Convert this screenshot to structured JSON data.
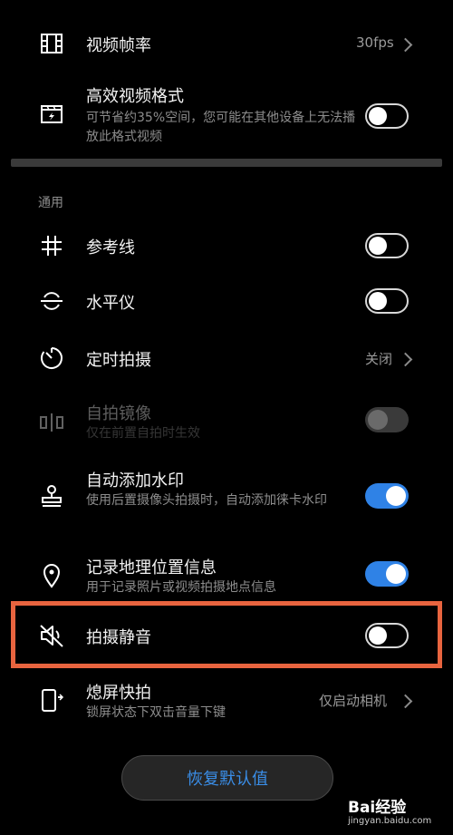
{
  "settings": {
    "frame_rate": {
      "title": "视频帧率",
      "value": "30fps",
      "icon": "film-icon"
    },
    "efficient_format": {
      "title": "高效视频格式",
      "desc": "可节省约35%空间，您可能在其他设备上无法播放此格式视频",
      "toggle": "off",
      "icon": "video-format-icon"
    },
    "section_general": "通用",
    "grid": {
      "title": "参考线",
      "toggle": "off",
      "icon": "grid-icon"
    },
    "level": {
      "title": "水平仪",
      "toggle": "off",
      "icon": "level-icon"
    },
    "timer": {
      "title": "定时拍摄",
      "value": "关闭",
      "icon": "timer-icon"
    },
    "mirror": {
      "title": "自拍镜像",
      "desc": "仅在前置自拍时生效",
      "toggle": "disabled",
      "icon": "mirror-icon"
    },
    "watermark": {
      "title": "自动添加水印",
      "desc": "使用后置摄像头拍摄时，自动添加徕卡水印",
      "toggle": "on",
      "icon": "stamp-icon"
    },
    "location": {
      "title": "记录地理位置信息",
      "desc": "用于记录照片或视频拍摄地点信息",
      "toggle": "on",
      "icon": "location-pin-icon"
    },
    "mute": {
      "title": "拍摄静音",
      "toggle": "off",
      "icon": "mute-icon",
      "highlight_color": "#e8643f"
    },
    "snapshot": {
      "title": "熄屏快拍",
      "desc": "锁屏状态下双击音量下键",
      "value": "仅启动相机",
      "icon": "phone-snapshot-icon"
    }
  },
  "reset_button": "恢复默认值",
  "watermark": {
    "brand": "Bai经验",
    "url": "jingyan.baidu.com"
  },
  "colors": {
    "accent": "#2f82e6",
    "highlight": "#e8643f",
    "background": "#000000"
  }
}
